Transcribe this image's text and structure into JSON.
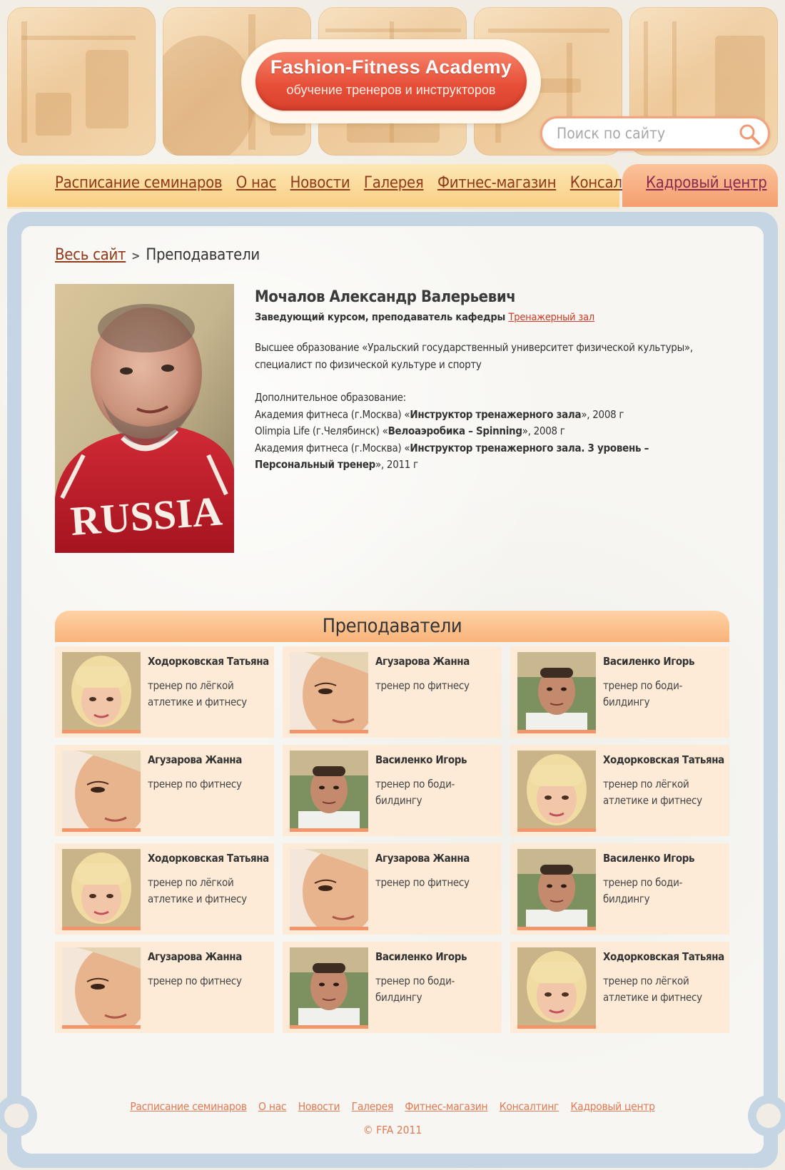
{
  "logo": {
    "title": "Fashion-Fitness Academy",
    "subtitle": "обучение тренеров и инструкторов"
  },
  "search": {
    "placeholder": "Поиск по сайту"
  },
  "nav": {
    "items": [
      {
        "label": "Расписание семинаров"
      },
      {
        "label": "О нас"
      },
      {
        "label": "Новости"
      },
      {
        "label": "Галерея"
      },
      {
        "label": "Фитнес-магазин"
      },
      {
        "label": "Консалтинг"
      }
    ],
    "hr_label": "Кадровый центр"
  },
  "breadcrumb": {
    "root": "Весь сайт",
    "separator": ">",
    "current": "Преподаватели"
  },
  "profile": {
    "name": "Мочалов Александр Валерьевич",
    "role": "Заведующий курсом, преподаватель кафедры",
    "department_link": "Тренажерный зал",
    "education": "Высшее образование «Уральский государственный университет физической культуры», специалист по физической культуре и спорту",
    "additional_title": "Дополнительное образование:",
    "courses": [
      {
        "prefix": "Академия фитнеса (г.Москва) «",
        "course": "Инструктор тренажерного зала",
        "suffix": "», 2008 г"
      },
      {
        "prefix": "Olimpia Life (г.Челябинск) «",
        "course": "Велоаэробика – Spinning",
        "suffix": "», 2008 г"
      },
      {
        "prefix": "Академия фитнеса (г.Москва) «",
        "course": "Инструктор тренажерного зала. 3 уровень – Персональный тренер",
        "suffix": "», 2011 г"
      }
    ],
    "shirt_text": "RUSSIA"
  },
  "teachers": {
    "title": "Преподаватели",
    "cards": [
      {
        "name": "Ходорковская Татьяна",
        "role": "тренер по лёгкой атлетике и фитнесу",
        "photo": "blonde"
      },
      {
        "name": "Агузарова Жанна",
        "role": "тренер по фитнесу",
        "photo": "woman"
      },
      {
        "name": "Василенко Игорь",
        "role": "тренер по боди-билдингу",
        "photo": "man"
      },
      {
        "name": "Агузарова Жанна",
        "role": "тренер по фитнесу",
        "photo": "woman"
      },
      {
        "name": "Василенко Игорь",
        "role": "тренер по боди-билдингу",
        "photo": "man"
      },
      {
        "name": "Ходорковская Татьяна",
        "role": "тренер по лёгкой атлетике и фитнесу",
        "photo": "blonde"
      },
      {
        "name": "Ходорковская Татьяна",
        "role": "тренер по лёгкой атлетике и фитнесу",
        "photo": "blonde"
      },
      {
        "name": "Агузарова Жанна",
        "role": "тренер по фитнесу",
        "photo": "woman"
      },
      {
        "name": "Василенко Игорь",
        "role": "тренер по боди-билдингу",
        "photo": "man"
      },
      {
        "name": "Агузарова Жанна",
        "role": "тренер по фитнесу",
        "photo": "woman"
      },
      {
        "name": "Василенко Игорь",
        "role": "тренер по боди-билдингу",
        "photo": "man"
      },
      {
        "name": "Ходорковская Татьяна",
        "role": "тренер по лёгкой атлетике и фитнесу",
        "photo": "blonde"
      }
    ]
  },
  "footer": {
    "links": [
      {
        "label": "Расписание семинаров"
      },
      {
        "label": "О нас"
      },
      {
        "label": "Новости"
      },
      {
        "label": "Галерея"
      },
      {
        "label": "Фитнес-магазин"
      },
      {
        "label": "Консалтинг"
      },
      {
        "label": "Кадровый центр"
      }
    ],
    "copyright": "© FFA 2011"
  },
  "colors": {
    "accent": "#e8503a",
    "nav_link": "#8f3a1a",
    "hr_link": "#8a2a52",
    "footer_link": "#e07a55",
    "frame": "#c5d5e4",
    "card_bg": "#fdebd8"
  }
}
